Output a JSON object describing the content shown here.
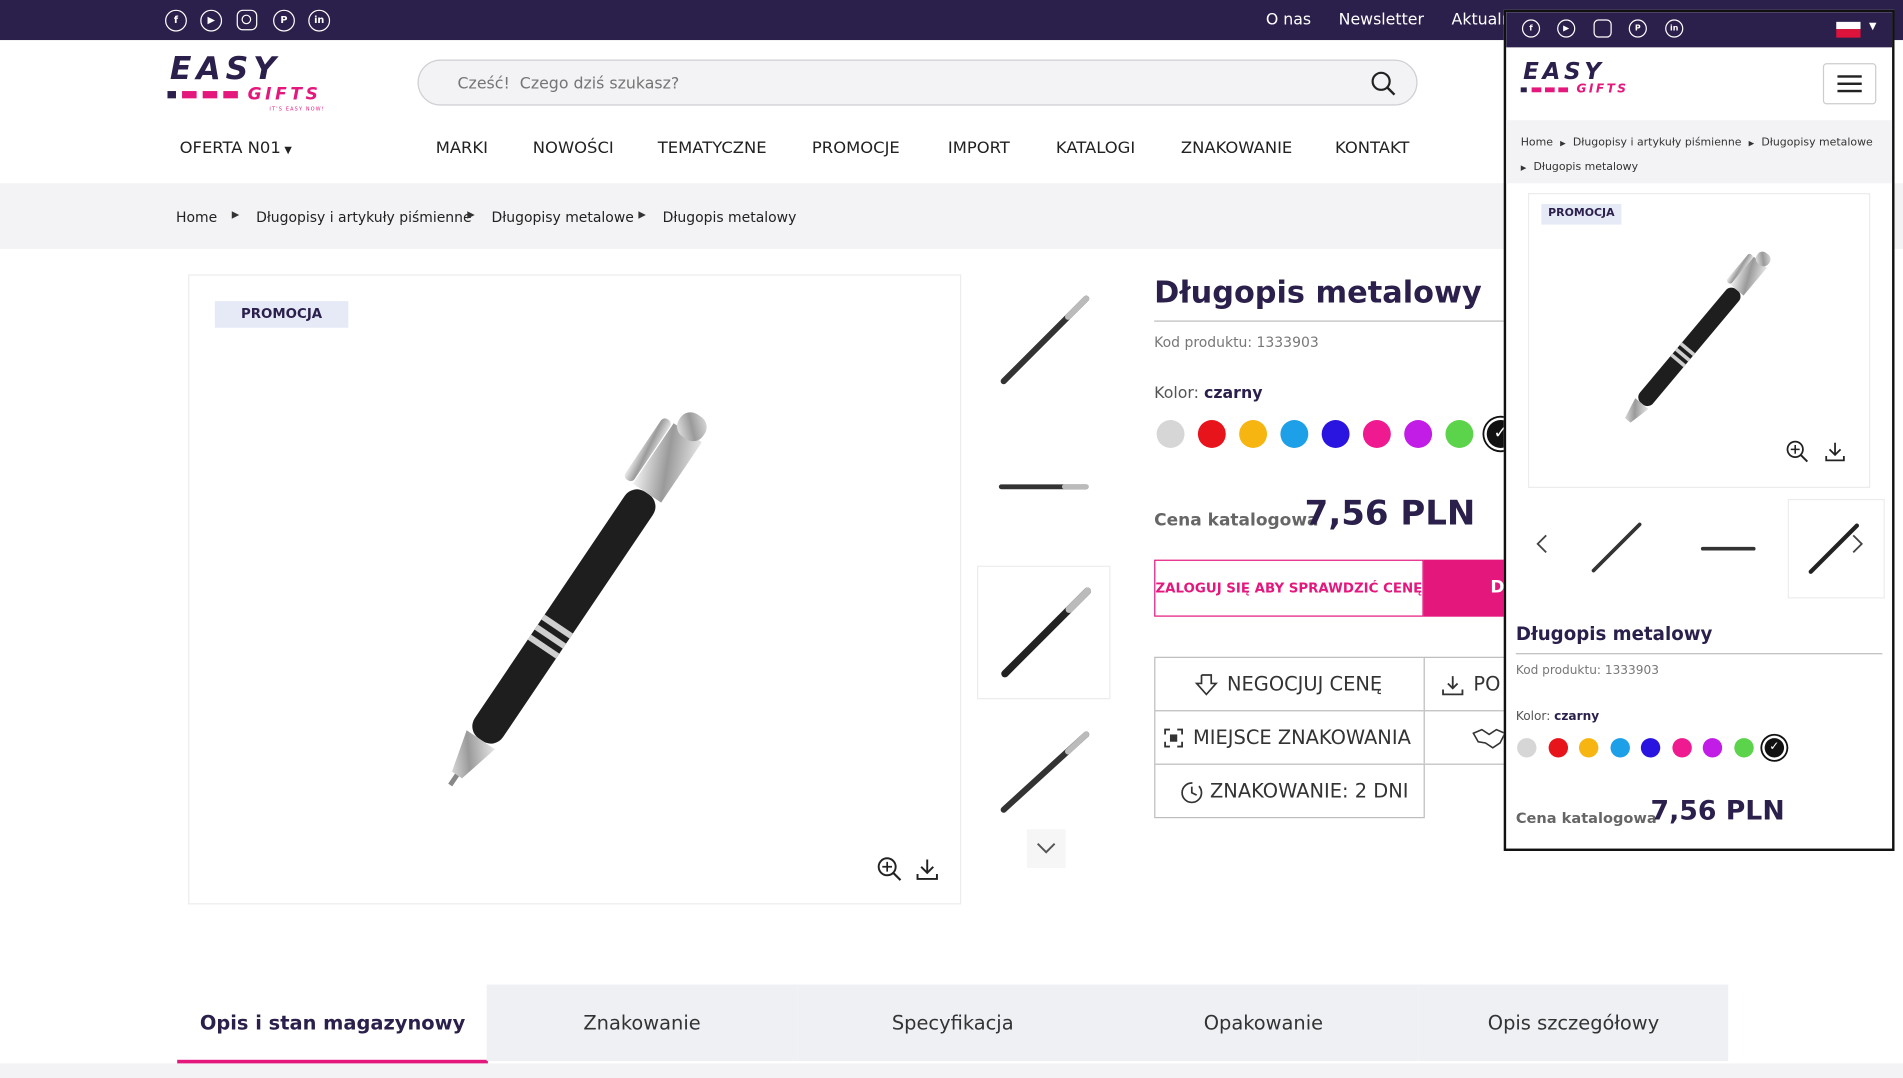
{
  "topbar": {
    "social_icons": [
      "facebook-icon",
      "youtube-icon",
      "instagram-icon",
      "pinterest-icon",
      "linkedin-icon"
    ],
    "links": [
      "O nas",
      "Newsletter",
      "Aktualn"
    ]
  },
  "logo": {
    "main": "EASY",
    "sub": "GIFTS",
    "tagline": "IT'S EASY NOW!"
  },
  "search": {
    "placeholder": "Cześć!  Czego dziś szukasz?"
  },
  "nav": {
    "offer": "OFERTA N01",
    "items": [
      "MARKI",
      "NOWOŚCI",
      "TEMATYCZNE",
      "PROMOCJE",
      "IMPORT",
      "KATALOGI",
      "ZNAKOWANIE",
      "KONTAKT"
    ]
  },
  "breadcrumb": [
    "Home",
    "Długopisy i artykuły piśmienne",
    "Długopisy metalowe",
    "Długopis metalowy"
  ],
  "product": {
    "badge": "PROMOCJA",
    "title": "Długopis metalowy",
    "code": "Kod produktu: 1333903",
    "color_label": "Kolor:",
    "color_value": "czarny",
    "swatches": [
      "#d6d6d6",
      "#e8141c",
      "#f7b512",
      "#1ea0e8",
      "#2a14e0",
      "#ef1a8f",
      "#c21de6",
      "#5bd34a",
      "#111111"
    ],
    "price_label": "Cena katalogowa",
    "price": "7,56 PLN",
    "login_btn": "ZALOGUJ SIĘ ABY SPRAWDZIĆ CENĘ",
    "add_btn": "D",
    "actions": {
      "negotiate": "NEGOCJUJ CENĘ",
      "download": "PO",
      "marking_place": "MIEJSCE ZNAKOWANIA",
      "marking_time": "ZNAKOWANIE: 2 DNI"
    }
  },
  "tabs": [
    "Opis i stan magazynowy",
    "Znakowanie",
    "Specyfikacja",
    "Opakowanie",
    "Opis szczegółowy"
  ],
  "colors": {
    "brand_dark": "#2b1f4b",
    "accent": "#e4177d"
  },
  "mobile": {
    "breadcrumb_line1": [
      "Home",
      "Długopisy i artykuły piśmienne",
      "Długopisy metalowe"
    ],
    "breadcrumb_line2": "Długopis metalowy",
    "badge": "PROMOCJA",
    "title": "Długopis metalowy",
    "code": "Kod produktu: 1333903",
    "color_label": "Kolor:",
    "color_value": "czarny",
    "price_label": "Cena katalogowa",
    "price": "7,56 PLN"
  }
}
